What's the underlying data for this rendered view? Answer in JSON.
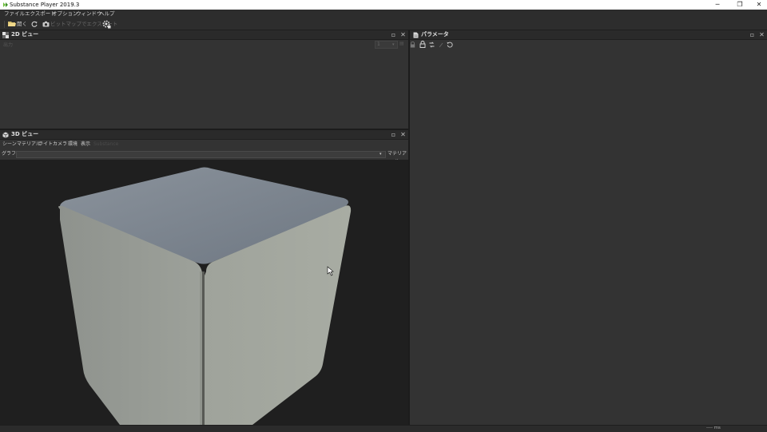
{
  "app": {
    "title": "Substance Player 2019.3"
  },
  "window_controls": {
    "minimize": "─",
    "restore": "❐",
    "close": "✕"
  },
  "menu": {
    "items": [
      "ファイル",
      "エクスポート",
      "オプション",
      "ウィンドウ",
      "ヘルプ"
    ]
  },
  "toolbar": {
    "open_label": "開く",
    "export_bitmap_label": "ビットマップでエクスポート"
  },
  "panel_2d": {
    "title": "2D ビュー",
    "output_label": "出力",
    "combo_value": "1"
  },
  "panel_3d": {
    "title": "3D ビュー",
    "menus": [
      "シーン",
      "マテリアル",
      "ライト",
      "カメラ",
      "環境",
      "表示"
    ],
    "disabled_menu": "Substance",
    "graph_label": "グラフ:",
    "graph_value": "",
    "material_button": "マテリアル"
  },
  "panel_params": {
    "title": "パラメータ"
  },
  "status": {
    "text": "---- ms"
  },
  "colors": {
    "accent_green": "#6fbf3a",
    "panel_bg": "#333333",
    "viewport_bg": "#1f1f1f"
  }
}
